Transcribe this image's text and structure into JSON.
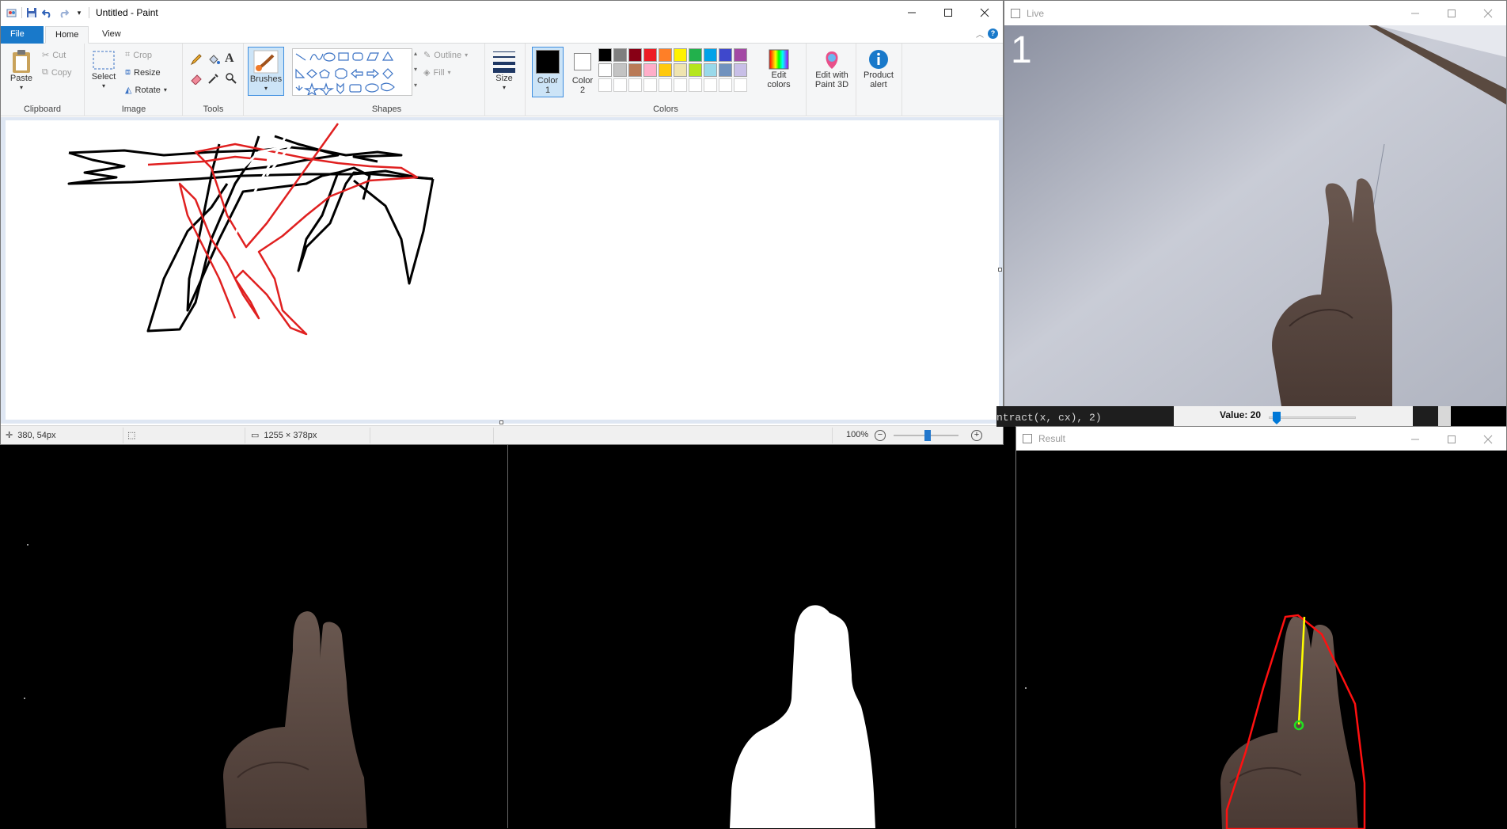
{
  "paint": {
    "title": "Untitled - Paint",
    "tabs": [
      "File",
      "Home",
      "View"
    ],
    "clipboard": {
      "paste": "Paste",
      "cut": "Cut",
      "copy": "Copy",
      "label": "Clipboard"
    },
    "image": {
      "select": "Select",
      "crop": "Crop",
      "resize": "Resize",
      "rotate": "Rotate",
      "label": "Image"
    },
    "tools": {
      "label": "Tools"
    },
    "brushes": "Brushes",
    "shapes": {
      "outline": "Outline",
      "fill": "Fill",
      "label": "Shapes"
    },
    "size": "Size",
    "color1": "Color\n1",
    "color2": "Color\n2",
    "color1_l1": "Color",
    "color1_l2": "1",
    "color2_l1": "Color",
    "color2_l2": "2",
    "colors_label": "Colors",
    "edit_colors_l1": "Edit",
    "edit_colors_l2": "colors",
    "paint3d_l1": "Edit with",
    "paint3d_l2": "Paint 3D",
    "product_alert_l1": "Product",
    "product_alert_l2": "alert",
    "palette": [
      "#000000",
      "#7f7f7f",
      "#880015",
      "#ed1c24",
      "#ff7f27",
      "#fff200",
      "#22b14c",
      "#00a2e8",
      "#3f48cc",
      "#a349a4",
      "#ffffff",
      "#c3c3c3",
      "#b97a57",
      "#ffaec9",
      "#ffc90e",
      "#efe4b0",
      "#b5e61d",
      "#99d9ea",
      "#7092be",
      "#c8bfe7"
    ],
    "status": {
      "cursor": "380, 54px",
      "size": "1255 × 378px",
      "zoom": "100%"
    }
  },
  "live": {
    "title": "Live",
    "overlay_number": "1",
    "code_snippet": "ntract(x, cx), 2)",
    "trackbar_label": "Value: 20",
    "trackbar_value": 20
  },
  "result": {
    "title": "Result"
  }
}
